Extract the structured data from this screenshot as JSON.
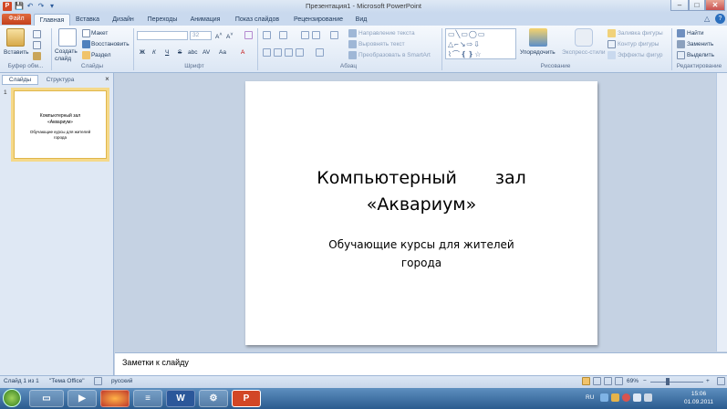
{
  "window": {
    "title": "Презентация1 - Microsoft PowerPoint",
    "app_icon": "P",
    "minimize": "–",
    "maximize": "□",
    "close": "✕",
    "help": "?",
    "collapse": "△"
  },
  "quick_access": {
    "save": "💾",
    "undo": "↶",
    "redo": "↷",
    "customize": "▾"
  },
  "tabs": {
    "file": "Файл",
    "items": [
      "Главная",
      "Вставка",
      "Дизайн",
      "Переходы",
      "Анимация",
      "Показ слайдов",
      "Рецензирование",
      "Вид"
    ]
  },
  "ribbon": {
    "clipboard": {
      "paste": "Вставить",
      "label": "Буфер обм..."
    },
    "slides": {
      "new_slide": "Создать слайд",
      "layout": "Макет",
      "reset": "Восстановить",
      "section": "Раздел",
      "label": "Слайды"
    },
    "font": {
      "size": "32",
      "bold": "Ж",
      "italic": "К",
      "underline": "Ч",
      "strike": "S",
      "shadow": "abc",
      "spacing": "AV",
      "case": "Aa",
      "color": "A",
      "label": "Шрифт"
    },
    "paragraph": {
      "text_direction": "Направление текста",
      "align_text": "Выровнять текст",
      "smartart": "Преобразовать в SmartArt",
      "label": "Абзац"
    },
    "drawing": {
      "arrange": "Упорядочить",
      "quick_styles": "Экспресс-стили",
      "fill": "Заливка фигуры",
      "outline": "Контур фигуры",
      "effects": "Эффекты фигур",
      "label": "Рисование"
    },
    "editing": {
      "find": "Найти",
      "replace": "Заменить",
      "select": "Выделить",
      "label": "Редактирование"
    }
  },
  "left_pane": {
    "tab_slides": "Слайды",
    "tab_outline": "Структура",
    "close": "×",
    "slide_number": "1"
  },
  "slide": {
    "title_line1": "Компьютерный зал",
    "title_line2": "«Аквариум»",
    "subtitle_line1": "Обучающие курсы для жителей",
    "subtitle_line2": "города"
  },
  "notes": {
    "placeholder": "Заметки к слайду"
  },
  "status": {
    "slide_info": "Слайд 1 из 1",
    "theme": "\"Тема Office\"",
    "language": "русский",
    "zoom": "69%",
    "zoom_minus": "−",
    "zoom_plus": "+"
  },
  "taskbar": {
    "tray_lang": "RU",
    "time": "15:06",
    "date": "01.09.2011",
    "apps": [
      "folder",
      "media",
      "firefox",
      "notepad",
      "word",
      "settings",
      "powerpoint"
    ]
  }
}
